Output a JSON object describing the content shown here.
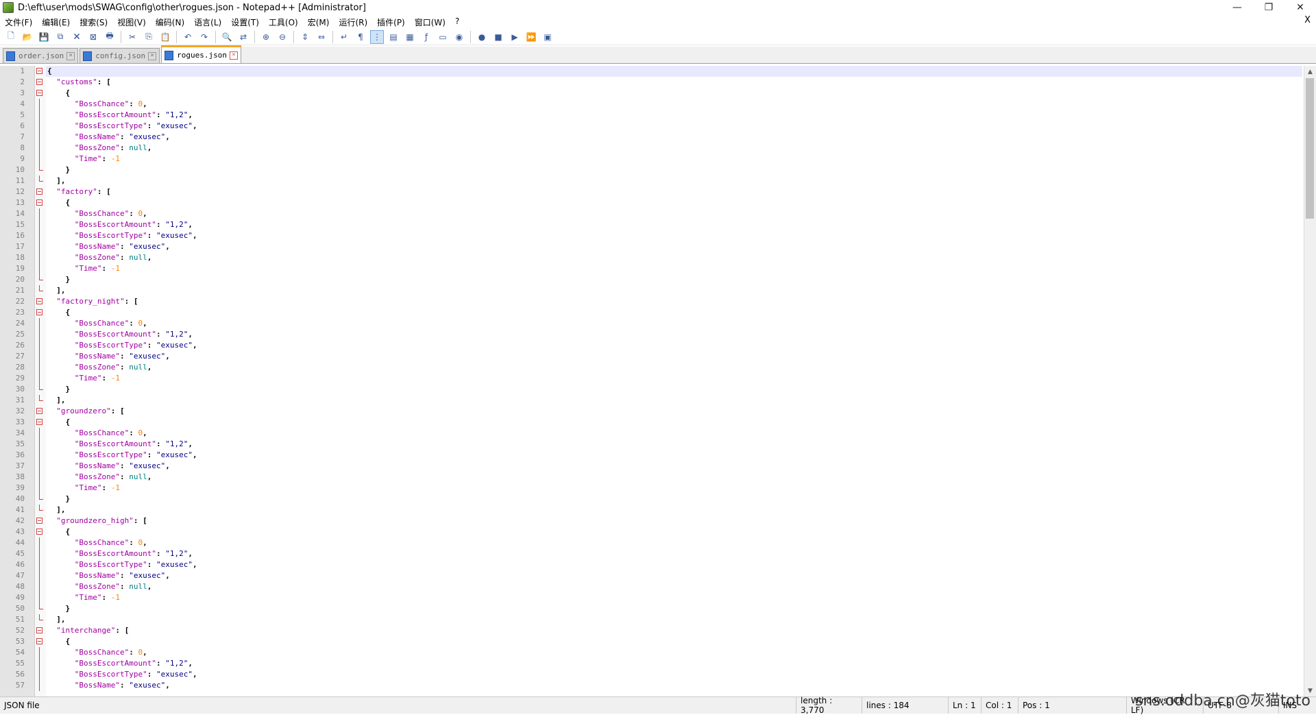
{
  "window": {
    "title": "D:\\eft\\user\\mods\\SWAG\\config\\other\\rogues.json - Notepad++ [Administrator]",
    "minimize": "—",
    "restore": "❐",
    "close": "✕"
  },
  "menu": {
    "items": [
      "文件(F)",
      "编辑(E)",
      "搜索(S)",
      "视图(V)",
      "编码(N)",
      "语言(L)",
      "设置(T)",
      "工具(O)",
      "宏(M)",
      "运行(R)",
      "插件(P)",
      "窗口(W)",
      "?"
    ],
    "close_doc": "X"
  },
  "toolbar": {
    "buttons": [
      {
        "icon": "new-file-icon",
        "glyph": "🗋"
      },
      {
        "icon": "open-file-icon",
        "glyph": "📂"
      },
      {
        "icon": "save-icon",
        "glyph": "💾"
      },
      {
        "icon": "save-all-icon",
        "glyph": "⧉"
      },
      {
        "icon": "close-file-icon",
        "glyph": "🗙"
      },
      {
        "icon": "close-all-icon",
        "glyph": "⊠"
      },
      {
        "icon": "print-icon",
        "glyph": "🖶"
      },
      {
        "sep": true
      },
      {
        "icon": "cut-icon",
        "glyph": "✂"
      },
      {
        "icon": "copy-icon",
        "glyph": "⎘"
      },
      {
        "icon": "paste-icon",
        "glyph": "📋"
      },
      {
        "sep": true
      },
      {
        "icon": "undo-icon",
        "glyph": "↶"
      },
      {
        "icon": "redo-icon",
        "glyph": "↷"
      },
      {
        "sep": true
      },
      {
        "icon": "find-icon",
        "glyph": "🔍"
      },
      {
        "icon": "replace-icon",
        "glyph": "⇄"
      },
      {
        "sep": true
      },
      {
        "icon": "zoom-in-icon",
        "glyph": "⊕"
      },
      {
        "icon": "zoom-out-icon",
        "glyph": "⊖"
      },
      {
        "sep": true
      },
      {
        "icon": "sync-vertical-icon",
        "glyph": "⇕"
      },
      {
        "icon": "sync-horizontal-icon",
        "glyph": "⇔"
      },
      {
        "sep": true
      },
      {
        "icon": "word-wrap-icon",
        "glyph": "↵"
      },
      {
        "icon": "show-all-chars-icon",
        "glyph": "¶"
      },
      {
        "icon": "indent-guide-icon",
        "glyph": "⋮",
        "active": true
      },
      {
        "icon": "user-language-icon",
        "glyph": "▤"
      },
      {
        "icon": "document-map-icon",
        "glyph": "▦"
      },
      {
        "icon": "function-list-icon",
        "glyph": "ƒ"
      },
      {
        "icon": "folder-workspace-icon",
        "glyph": "▭"
      },
      {
        "icon": "monitoring-icon",
        "glyph": "◉"
      },
      {
        "sep": true
      },
      {
        "icon": "record-macro-icon",
        "glyph": "●"
      },
      {
        "icon": "stop-macro-icon",
        "glyph": "■"
      },
      {
        "icon": "play-macro-icon",
        "glyph": "▶"
      },
      {
        "icon": "run-macro-multiple-icon",
        "glyph": "⏩"
      },
      {
        "icon": "save-macro-icon",
        "glyph": "▣"
      }
    ]
  },
  "tabs": [
    {
      "label": "order.json",
      "active": false
    },
    {
      "label": "config.json",
      "active": false
    },
    {
      "label": "rogues.json",
      "active": true
    }
  ],
  "editor": {
    "maps": [
      "customs",
      "factory",
      "factory_night",
      "groundzero",
      "groundzero_high",
      "interchange"
    ],
    "fields": {
      "chance_key": "\"BossChance\"",
      "chance_val": "0",
      "amount_key": "\"BossEscortAmount\"",
      "amount_val": "\"1,2\"",
      "type_key": "\"BossEscortType\"",
      "type_val": "\"exusec\"",
      "name_key": "\"BossName\"",
      "name_val": "\"exusec\"",
      "zone_key": "\"BossZone\"",
      "zone_val": "null",
      "time_key": "\"Time\"",
      "time_val": "-1"
    },
    "visible_lines": 57
  },
  "status": {
    "file_type": "JSON file",
    "length": "length : 3,770",
    "lines": "lines : 184",
    "ln": "Ln : 1",
    "col": "Col : 1",
    "pos": "Pos : 1",
    "eol": "Windows (CR LF)",
    "encoding": "UTF-8",
    "mode": "INS"
  },
  "watermark": "sns.oddba.cn@灰猫toto"
}
